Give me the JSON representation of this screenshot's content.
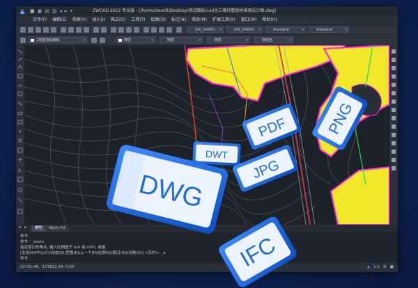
{
  "app": {
    "title": "ZWCAD 2022 专业版 - [/home/zwsoft/Desktop/测试图纸/cad全三维别墅园林景观设计图.dwg]"
  },
  "quick_access": [
    "■",
    "▣",
    "▤",
    "▥",
    "◂",
    "▸",
    "▾"
  ],
  "menu": [
    "文件(F)",
    "编辑(E)",
    "视图(V)",
    "插入(I)",
    "格式(O)",
    "工具(T)",
    "绘图(D)",
    "标注(N)",
    "修改(M)",
    "扩展工具(X)",
    "窗口(W)",
    "帮助(H)"
  ],
  "toolbar": {
    "text_style": "ZW_GREEN",
    "dim_style": "ZW_GREEN",
    "table_style": "Standard",
    "multileader_style": "Standard",
    "layer": "1地基测绘编辑",
    "color": "随层",
    "linetype": "随层",
    "lineweight": "随层",
    "plotstyle": "随颜色"
  },
  "tabs": [
    "模型",
    "Work (4)"
  ],
  "command": {
    "lines": [
      "命令:",
      "命令: '_zoom",
      "指定窗口的角点, 输入比例因子 (nX 或 nXP), 或者",
      "[全部(A)/中心(C)/动态(D)/范围(E)/上一个(P)/比例(S)/窗口(W)/对象(O)] <实时>: _e",
      "命令:"
    ]
  },
  "status": {
    "coords": "-32701.46, -173812.94, 0.00",
    "scale": "1:1"
  },
  "file_cards": [
    "DWG",
    "DWT",
    "PDF",
    "JPG",
    "PNG",
    "IFC"
  ],
  "colors": {
    "accent": "#1f6fd6",
    "canvas": "#1d2128",
    "background": "#0f2558",
    "yellow_zone": "#f2e82a",
    "magenta_outline": "#ff2bd6"
  }
}
